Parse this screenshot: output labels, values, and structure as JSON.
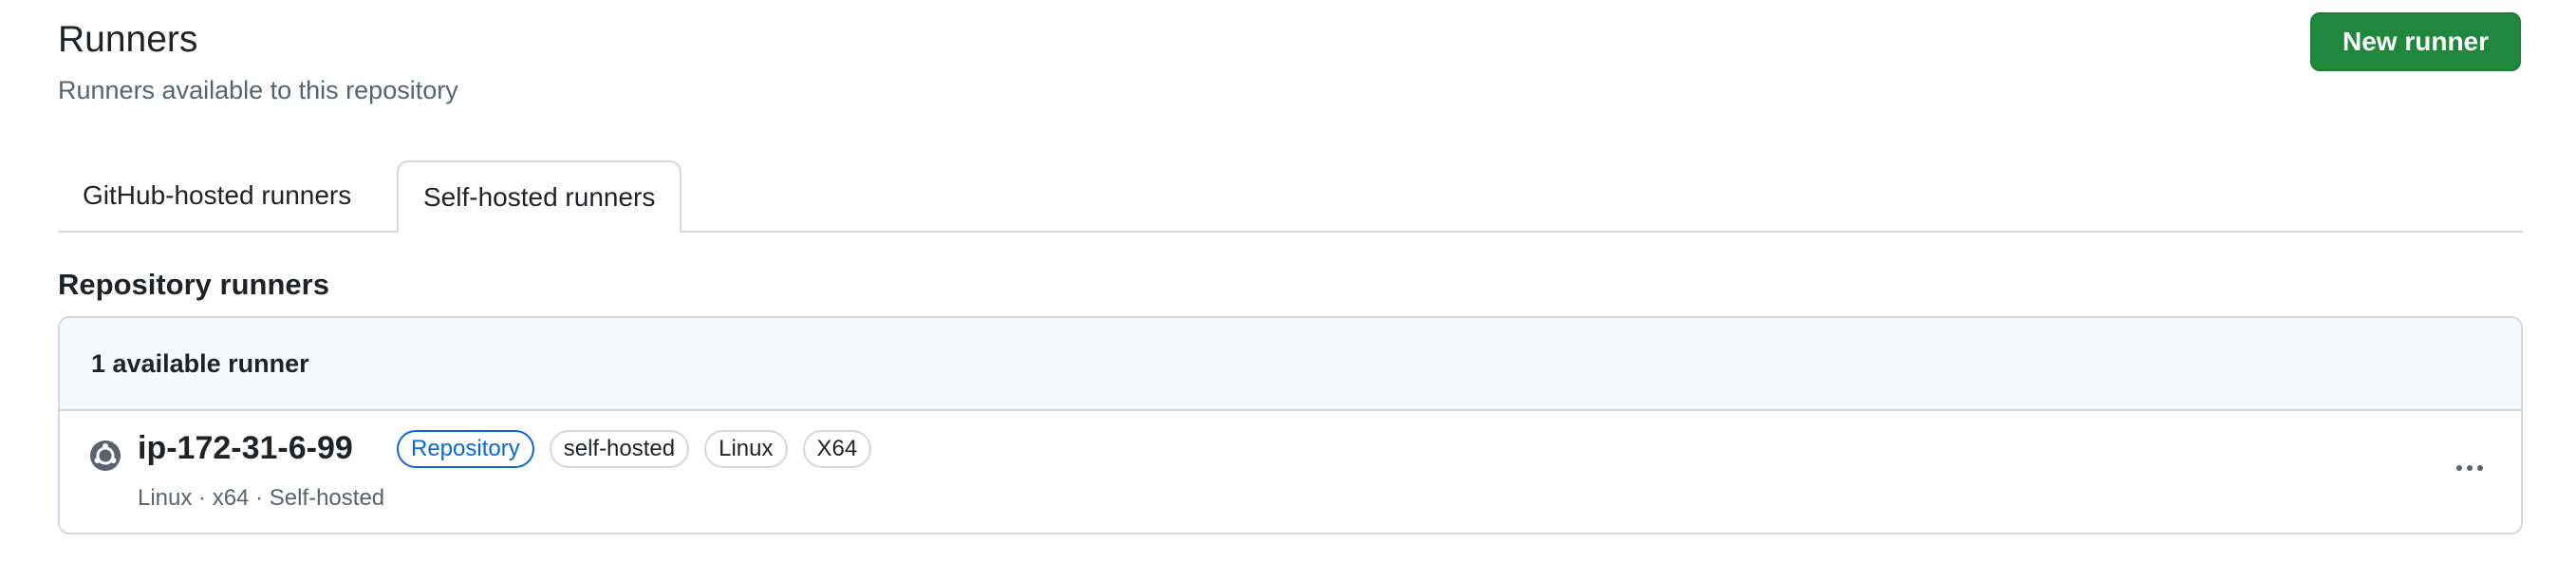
{
  "header": {
    "title": "Runners",
    "subtitle": "Runners available to this repository",
    "new_runner_label": "New runner"
  },
  "tabs": [
    {
      "label": "GitHub-hosted runners",
      "selected": false
    },
    {
      "label": "Self-hosted runners",
      "selected": true
    }
  ],
  "section": {
    "title": "Repository runners",
    "count_text": "1 available runner"
  },
  "runners": [
    {
      "name": "ip-172-31-6-99",
      "icon": "ubuntu-icon",
      "labels": [
        "Repository",
        "self-hosted",
        "Linux",
        "X64"
      ],
      "meta": "Linux · x64 · Self-hosted"
    }
  ],
  "colors": {
    "primary_button": "#1f883d",
    "accent": "#0969da",
    "border": "#d1d9e0",
    "muted_text": "#59636e"
  }
}
